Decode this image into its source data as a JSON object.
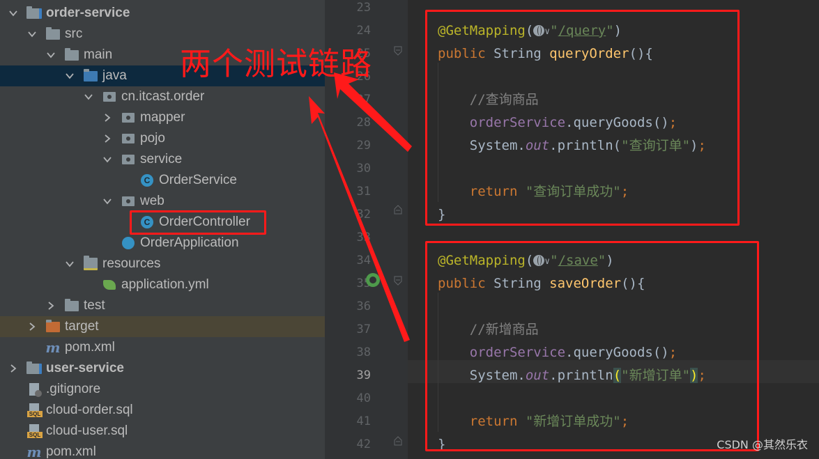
{
  "project_tree": {
    "rows": [
      {
        "label": "order-service",
        "depth": 0,
        "expanded": true,
        "icon": "module-folder-icon",
        "bold": true
      },
      {
        "label": "src",
        "depth": 1,
        "expanded": true,
        "icon": "folder-icon"
      },
      {
        "label": "main",
        "depth": 2,
        "expanded": true,
        "icon": "folder-icon"
      },
      {
        "label": "java",
        "depth": 3,
        "expanded": true,
        "icon": "source-folder-icon",
        "selected": true
      },
      {
        "label": "cn.itcast.order",
        "depth": 4,
        "expanded": true,
        "icon": "package-icon"
      },
      {
        "label": "mapper",
        "depth": 5,
        "expanded": false,
        "icon": "package-icon"
      },
      {
        "label": "pojo",
        "depth": 5,
        "expanded": false,
        "icon": "package-icon"
      },
      {
        "label": "service",
        "depth": 5,
        "expanded": true,
        "icon": "package-icon"
      },
      {
        "label": "OrderService",
        "depth": 6,
        "icon": "class-icon"
      },
      {
        "label": "web",
        "depth": 5,
        "expanded": true,
        "icon": "package-icon"
      },
      {
        "label": "OrderController",
        "depth": 6,
        "icon": "class-icon",
        "boxed": true
      },
      {
        "label": "OrderApplication",
        "depth": 5,
        "icon": "spring-app-icon"
      },
      {
        "label": "resources",
        "depth": 3,
        "expanded": true,
        "icon": "resources-folder-icon"
      },
      {
        "label": "application.yml",
        "depth": 4,
        "icon": "spring-config-icon"
      },
      {
        "label": "test",
        "depth": 2,
        "expanded": false,
        "icon": "folder-icon"
      },
      {
        "label": "target",
        "depth": 1,
        "expanded": false,
        "icon": "excluded-folder-icon",
        "highlight": true
      },
      {
        "label": "pom.xml",
        "depth": 1,
        "icon": "maven-icon"
      },
      {
        "label": "user-service",
        "depth": 0,
        "expanded": false,
        "icon": "module-folder-icon",
        "bold": true
      },
      {
        "label": ".gitignore",
        "depth": 0,
        "icon": "gitignore-icon"
      },
      {
        "label": "cloud-order.sql",
        "depth": 0,
        "icon": "sql-icon"
      },
      {
        "label": "cloud-user.sql",
        "depth": 0,
        "icon": "sql-icon"
      },
      {
        "label": "pom.xml",
        "depth": 0,
        "icon": "maven-icon"
      }
    ]
  },
  "annotation": {
    "headline": "两个测试链路",
    "color": "#ff1a1a"
  },
  "editor": {
    "current_line": "39",
    "lines": [
      {
        "n": "23"
      },
      {
        "n": "24",
        "tokens": [
          [
            "ann",
            "@GetMapping"
          ],
          [
            "plain",
            "("
          ],
          [
            "globe",
            ""
          ],
          [
            "str",
            "\""
          ],
          [
            "url",
            "/query"
          ],
          [
            "str",
            "\""
          ],
          [
            "plain",
            ")"
          ]
        ]
      },
      {
        "n": "25",
        "tokens": [
          [
            "kw",
            "public "
          ],
          [
            "plain",
            "String "
          ],
          [
            "fn",
            "queryOrder"
          ],
          [
            "plain",
            "(){"
          ]
        ]
      },
      {
        "n": "26"
      },
      {
        "n": "27",
        "tokens": [
          [
            "cmt",
            "    //查询商品"
          ]
        ]
      },
      {
        "n": "28",
        "tokens": [
          [
            "fld",
            "    orderService"
          ],
          [
            "plain",
            ".queryGoods()"
          ],
          [
            "kw",
            ";"
          ]
        ]
      },
      {
        "n": "29",
        "tokens": [
          [
            "plain",
            "    System."
          ],
          [
            "itl",
            "out"
          ],
          [
            "plain",
            ".println("
          ],
          [
            "str",
            "\"查询订单\""
          ],
          [
            "plain",
            ")"
          ],
          [
            "kw",
            ";"
          ]
        ]
      },
      {
        "n": "30"
      },
      {
        "n": "31",
        "tokens": [
          [
            "kw",
            "    return "
          ],
          [
            "str",
            "\"查询订单成功\""
          ],
          [
            "kw",
            ";"
          ]
        ]
      },
      {
        "n": "32",
        "tokens": [
          [
            "plain",
            "}"
          ]
        ]
      },
      {
        "n": "33"
      },
      {
        "n": "34",
        "tokens": [
          [
            "ann",
            "@GetMapping"
          ],
          [
            "plain",
            "("
          ],
          [
            "globe",
            ""
          ],
          [
            "str",
            "\""
          ],
          [
            "url",
            "/save"
          ],
          [
            "str",
            "\""
          ],
          [
            "plain",
            ")"
          ]
        ]
      },
      {
        "n": "35",
        "tokens": [
          [
            "kw",
            "public "
          ],
          [
            "plain",
            "String "
          ],
          [
            "fn",
            "saveOrder"
          ],
          [
            "plain",
            "(){"
          ]
        ]
      },
      {
        "n": "36"
      },
      {
        "n": "37",
        "tokens": [
          [
            "cmt",
            "    //新增商品"
          ]
        ]
      },
      {
        "n": "38",
        "tokens": [
          [
            "fld",
            "    orderService"
          ],
          [
            "plain",
            ".queryGoods()"
          ],
          [
            "kw",
            ";"
          ]
        ]
      },
      {
        "n": "39",
        "tokens": [
          [
            "plain",
            "    System."
          ],
          [
            "itl",
            "out"
          ],
          [
            "plain",
            ".println"
          ],
          [
            "bh",
            "("
          ],
          [
            "str",
            "\"新增订单\""
          ],
          [
            "bh",
            ")"
          ],
          [
            "kw",
            ";"
          ]
        ]
      },
      {
        "n": "40"
      },
      {
        "n": "41",
        "tokens": [
          [
            "kw",
            "    return "
          ],
          [
            "str",
            "\"新增订单成功\""
          ],
          [
            "kw",
            ";"
          ]
        ]
      },
      {
        "n": "42",
        "tokens": [
          [
            "plain",
            "}"
          ]
        ]
      }
    ]
  },
  "watermark": "CSDN @其然乐衣"
}
